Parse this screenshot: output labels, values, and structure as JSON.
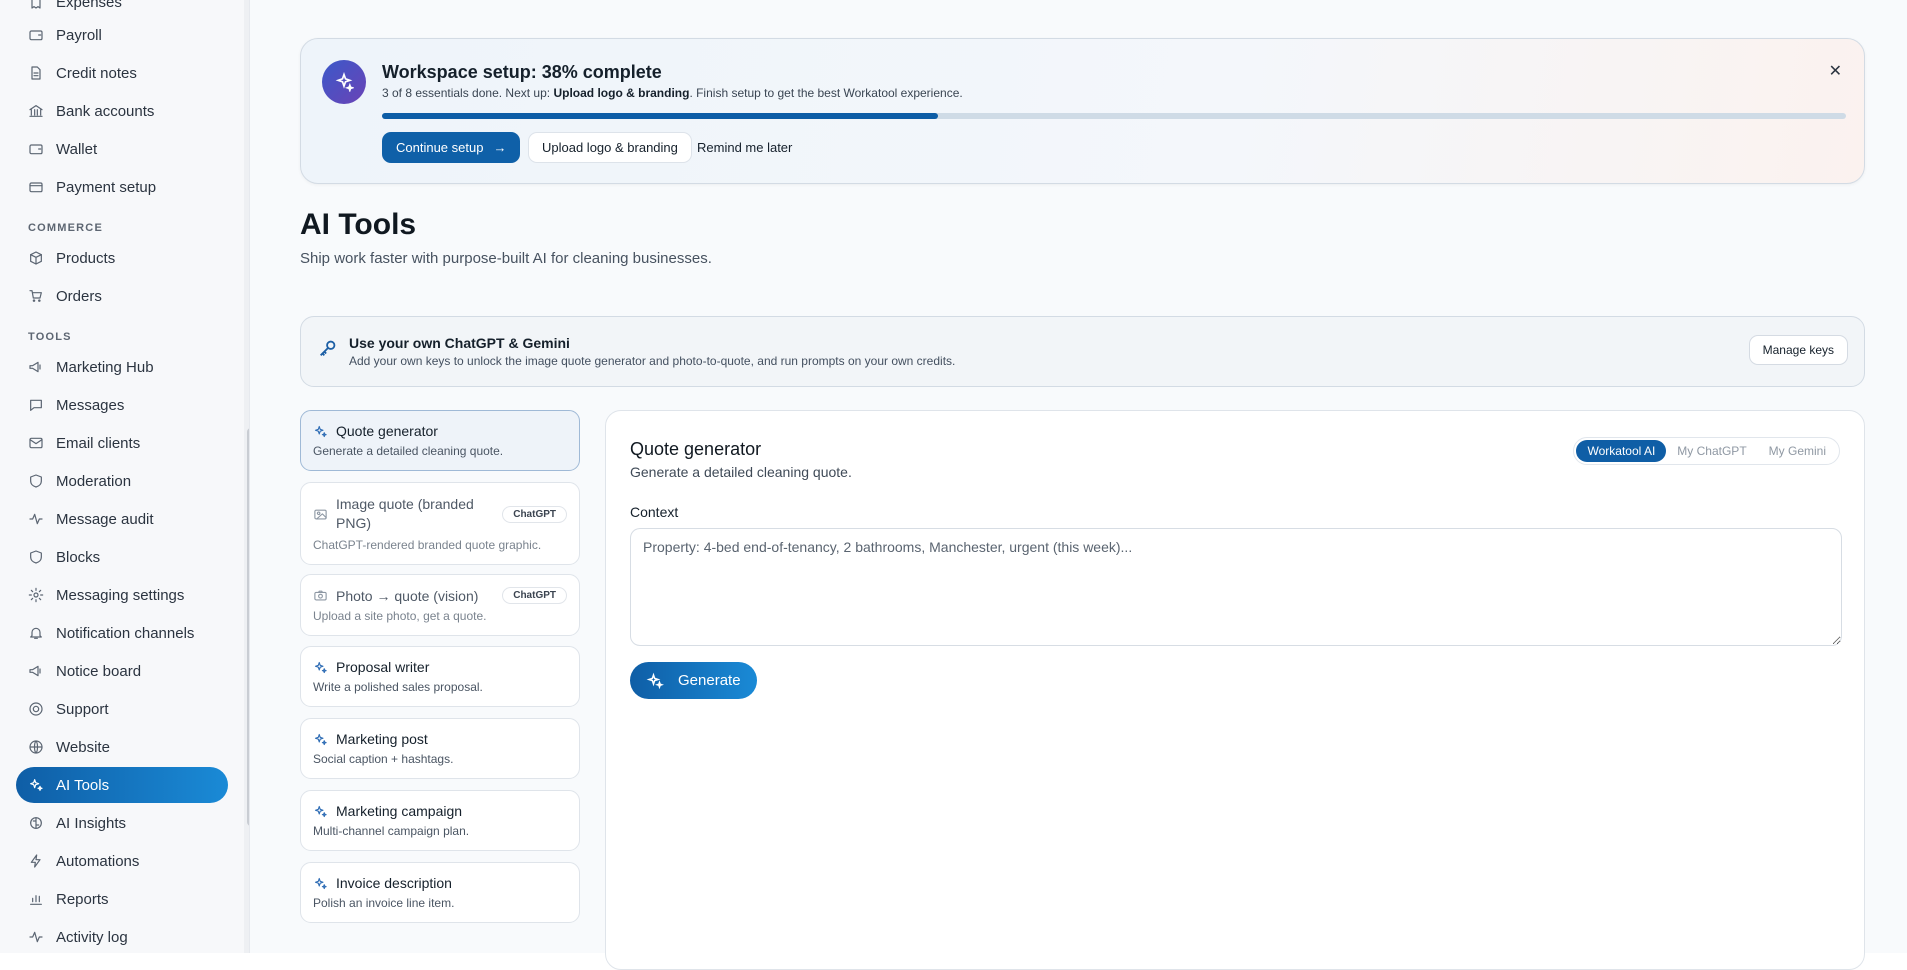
{
  "sidebar": {
    "items_top": [
      {
        "label": "Expenses",
        "icon": "receipt-icon"
      },
      {
        "label": "Payroll",
        "icon": "wallet-icon"
      },
      {
        "label": "Credit notes",
        "icon": "document-icon"
      },
      {
        "label": "Bank accounts",
        "icon": "bank-icon"
      },
      {
        "label": "Wallet",
        "icon": "wallet-icon"
      },
      {
        "label": "Payment setup",
        "icon": "card-icon"
      }
    ],
    "commerce_label": "COMMERCE",
    "commerce_items": [
      {
        "label": "Products",
        "icon": "box-icon"
      },
      {
        "label": "Orders",
        "icon": "cart-icon"
      }
    ],
    "tools_label": "TOOLS",
    "tools_items": [
      {
        "label": "Marketing Hub",
        "icon": "megaphone-icon"
      },
      {
        "label": "Messages",
        "icon": "chat-icon"
      },
      {
        "label": "Email clients",
        "icon": "mail-icon"
      },
      {
        "label": "Moderation",
        "icon": "shield-icon"
      },
      {
        "label": "Message audit",
        "icon": "pulse-icon"
      },
      {
        "label": "Blocks",
        "icon": "shield-icon"
      },
      {
        "label": "Messaging settings",
        "icon": "gear-icon"
      },
      {
        "label": "Notification channels",
        "icon": "bell-icon"
      },
      {
        "label": "Notice board",
        "icon": "megaphone-icon"
      },
      {
        "label": "Support",
        "icon": "lifebuoy-icon"
      },
      {
        "label": "Website",
        "icon": "globe-icon"
      },
      {
        "label": "AI Tools",
        "icon": "sparkles-icon"
      },
      {
        "label": "AI Insights",
        "icon": "brain-icon"
      },
      {
        "label": "Automations",
        "icon": "bolt-icon"
      },
      {
        "label": "Reports",
        "icon": "bar-chart-icon"
      },
      {
        "label": "Activity log",
        "icon": "pulse-icon"
      }
    ],
    "active": "AI Tools"
  },
  "banner": {
    "title": "Workspace setup: 38% complete",
    "sub_prefix": "3 of 8 essentials done. Next up: ",
    "sub_bold": "Upload logo & branding",
    "sub_suffix": ". Finish setup to get the best Workatool experience.",
    "progress": 0.38,
    "continue_label": "Continue setup",
    "upload_label": "Upload logo & branding",
    "remind_label": "Remind me later"
  },
  "page": {
    "title": "AI Tools",
    "subtitle": "Ship work faster with purpose-built AI for cleaning businesses."
  },
  "keys": {
    "title": "Use your own ChatGPT & Gemini",
    "subtitle": "Add your own keys to unlock the image quote generator and photo-to-quote, and run prompts on your own credits.",
    "manage_label": "Manage keys"
  },
  "tools": [
    {
      "name": "Quote generator",
      "desc": "Generate a detailed cleaning quote.",
      "badge": "",
      "selected": true
    },
    {
      "name": "Image quote (branded PNG)",
      "desc": "ChatGPT-rendered branded quote graphic.",
      "badge": "ChatGPT",
      "selected": false
    },
    {
      "name": "Photo → quote (vision)",
      "desc": "Upload a site photo, get a quote.",
      "badge": "ChatGPT",
      "selected": false
    },
    {
      "name": "Proposal writer",
      "desc": "Write a polished sales proposal.",
      "badge": "",
      "selected": false
    },
    {
      "name": "Marketing post",
      "desc": "Social caption + hashtags.",
      "badge": "",
      "selected": false
    },
    {
      "name": "Marketing campaign",
      "desc": "Multi-channel campaign plan.",
      "badge": "",
      "selected": false
    },
    {
      "name": "Invoice description",
      "desc": "Polish an invoice line item.",
      "badge": "",
      "selected": false
    }
  ],
  "panel": {
    "title": "Quote generator",
    "subtitle": "Generate a detailed cleaning quote.",
    "providers": [
      "Workatool AI",
      "My ChatGPT",
      "My Gemini"
    ],
    "active_provider": "Workatool AI",
    "context_label": "Context",
    "context_placeholder": "Property: 4-bed end-of-tenancy, 2 bathrooms, Manchester, urgent (this week)...",
    "generate_label": "Generate"
  }
}
